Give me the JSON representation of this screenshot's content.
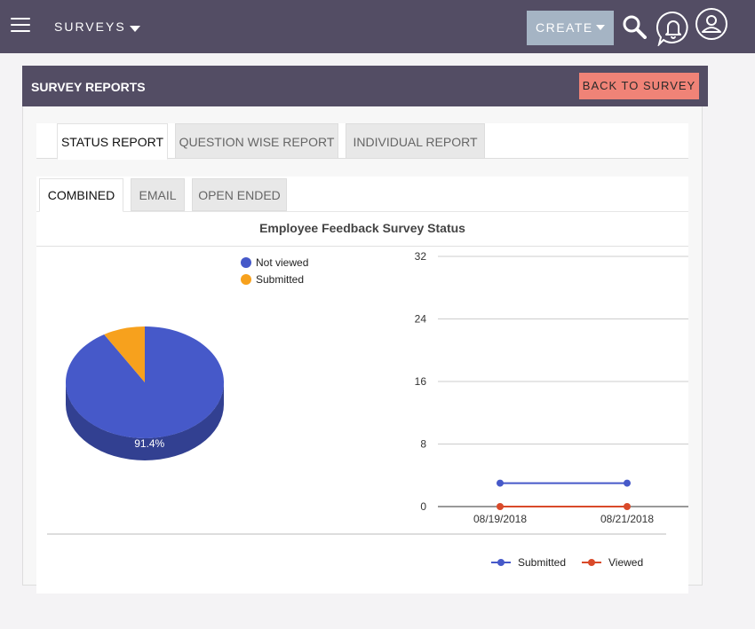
{
  "navbar": {
    "module_label": "SURVEYS",
    "create_label": "CREATE",
    "icons": [
      "menu-icon",
      "search-icon",
      "bell-icon",
      "user-icon"
    ]
  },
  "header": {
    "title": "SURVEY REPORTS",
    "back_label": "BACK TO SURVEY"
  },
  "report_tabs": [
    {
      "label": "STATUS REPORT",
      "active": true
    },
    {
      "label": "QUESTION WISE REPORT",
      "active": false
    },
    {
      "label": "INDIVIDUAL REPORT",
      "active": false
    }
  ],
  "sub_tabs": [
    {
      "label": "COMBINED",
      "active": true
    },
    {
      "label": "EMAIL",
      "active": false
    },
    {
      "label": "OPEN ENDED",
      "active": false
    }
  ],
  "chart_title": "Employee Feedback Survey Status",
  "colors": {
    "navbar": "#534d64",
    "create_button": "#a5b4c4",
    "back_button": "#f08377",
    "not_viewed": "#4659c9",
    "submitted_pie": "#f7a11d",
    "submitted_line": "#4659c9",
    "viewed_line": "#d94a2a"
  },
  "chart_data": [
    {
      "type": "pie",
      "title": "",
      "labels": [
        "Not viewed",
        "Submitted"
      ],
      "values": [
        91.4,
        8.6
      ],
      "value_labels": [
        "91.4%",
        ""
      ],
      "legend_position": "top"
    },
    {
      "type": "line",
      "title": "",
      "x": [
        "08/19/2018",
        "08/21/2018"
      ],
      "series": [
        {
          "name": "Submitted",
          "values": [
            3,
            3
          ]
        },
        {
          "name": "Viewed",
          "values": [
            0,
            0
          ]
        }
      ],
      "yticks": [
        0,
        8,
        16,
        24,
        32
      ],
      "ylim": [
        0,
        32
      ],
      "grid": true,
      "legend_position": "bottom"
    }
  ]
}
